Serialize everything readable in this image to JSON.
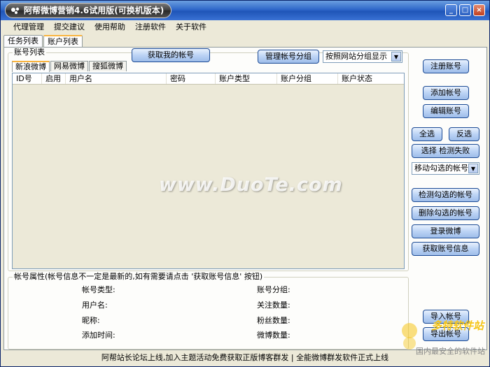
{
  "window": {
    "title": "阿帮微博营销4.6试用版(可换机版本)",
    "controls": {
      "minimize": "_",
      "maximize": "□",
      "close": "×"
    }
  },
  "menu": [
    "代理管理",
    "提交建议",
    "使用帮助",
    "注册软件",
    "关于软件"
  ],
  "main_tabs": [
    {
      "label": "任务列表",
      "active": false
    },
    {
      "label": "账户列表",
      "active": true
    }
  ],
  "account_list": {
    "group_label": "账号列表",
    "fetch_button": "获取我的帐号",
    "manage_group_button": "管理帐号分组",
    "group_display_select": "按照网站分组显示",
    "sub_tabs": [
      {
        "label": "新浪微博",
        "active": true
      },
      {
        "label": "网易微博",
        "active": false
      },
      {
        "label": "搜狐微博",
        "active": false
      }
    ],
    "columns": [
      "ID号",
      "启用",
      "用户名",
      "密码",
      "账户类型",
      "账户分组",
      "账户状态"
    ],
    "rows": []
  },
  "properties": {
    "group_label": "帐号属性(帐号信息不一定是最新的,如有需要请点击 '获取账号信息' 按钮)",
    "fields_left": [
      "帐号类型:",
      "用户名:",
      "昵称:",
      "添加时间:"
    ],
    "fields_right": [
      "账号分组:",
      "关注数量:",
      "粉丝数量:",
      "微博数量:"
    ]
  },
  "side_buttons": {
    "register": "注册账号",
    "add": "添加帐号",
    "edit": "编辑账号",
    "select_all": "全选",
    "invert": "反选",
    "select_failed": "选择 检测失败",
    "move_select": "移动勾选的帐号",
    "check_selected": "检测勾选的帐号",
    "delete_selected": "删除勾选的帐号",
    "login": "登录微博",
    "fetch_info": "获取账号信息",
    "import": "导入帐号",
    "export": "导出帐号"
  },
  "statusbar": "阿帮站长论坛上线,加入主题活动免费获取正版博客群发 | 全能微博群发软件正式上线",
  "watermarks": {
    "main": "www.DuoTe.com",
    "corner_1": "多特软件站",
    "corner_2": "国内最安全的软件站"
  }
}
